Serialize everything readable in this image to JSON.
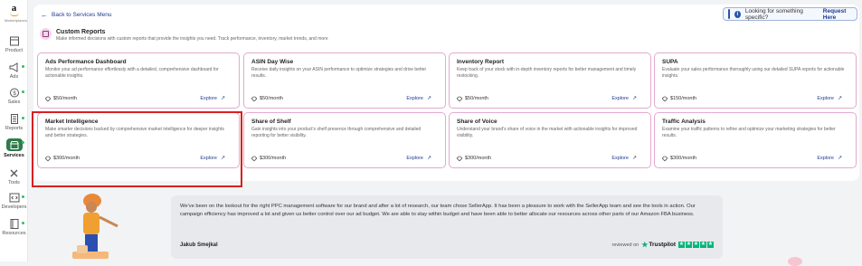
{
  "sidebar": {
    "logo_text": "a",
    "logo_sub": "Marketplaces",
    "items": [
      {
        "label": "Product",
        "icon": "box-icon",
        "active": false,
        "dot": false
      },
      {
        "label": "Ads",
        "icon": "megaphone-icon",
        "active": false,
        "dot": true
      },
      {
        "label": "Sales",
        "icon": "dollar-circle-icon",
        "active": false,
        "dot": true
      },
      {
        "label": "Reports",
        "icon": "document-icon",
        "active": false,
        "dot": true
      },
      {
        "label": "Services",
        "icon": "store-icon",
        "active": true,
        "dot": true
      },
      {
        "label": "Tools",
        "icon": "tools-icon",
        "active": false,
        "dot": false
      },
      {
        "label": "Developers",
        "icon": "code-icon",
        "active": false,
        "dot": true
      },
      {
        "label": "Resources",
        "icon": "book-icon",
        "active": false,
        "dot": true
      }
    ]
  },
  "header": {
    "back_label": "Back to Services Menu",
    "help_question": "Looking for something specific?",
    "help_link": "Request Here"
  },
  "section": {
    "title": "Custom Reports",
    "subtitle": "Make informed decisions with custom reports that provide the insights you need. Track performance, inventory, market trends, and more"
  },
  "cards": [
    {
      "title": "Ads Performance Dashboard",
      "desc": "Monitor your ad performance effortlessly with a detailed, comprehensive dashboard for actionable insights.",
      "price": "$50/month",
      "explore": "Explore"
    },
    {
      "title": "ASIN Day Wise",
      "desc": "Receive daily insights on your ASIN performance to optimize strategies and drive better results.",
      "price": "$50/month",
      "explore": "Explore"
    },
    {
      "title": "Inventory Report",
      "desc": "Keep track of your stock with in-depth inventory reports for better management and timely restocking.",
      "price": "$50/month",
      "explore": "Explore"
    },
    {
      "title": "SUPA",
      "desc": "Evaluate your sales performance thoroughly using our detailed SUPA reports for actionable insights.",
      "price": "$150/month",
      "explore": "Explore"
    },
    {
      "title": "Market Intelligence",
      "desc": "Make smarter decisions backed by comprehensive market intelligence for deeper insights and better strategies.",
      "price": "$300/month",
      "explore": "Explore"
    },
    {
      "title": "Share of Shelf",
      "desc": "Gain insights into your product's shelf presence through comprehensive and detailed reporting for better visibility.",
      "price": "$300/month",
      "explore": "Explore"
    },
    {
      "title": "Share of Voice",
      "desc": "Understand your brand's share of voice in the market with actionable insights for improved visibility.",
      "price": "$300/month",
      "explore": "Explore"
    },
    {
      "title": "Traffic Analysis",
      "desc": "Examine your traffic patterns to refine and optimize your marketing strategies for better results.",
      "price": "$300/month",
      "explore": "Explore"
    }
  ],
  "testimonial": {
    "text": "We've been on the lookout for the right PPC management software for our brand and after a lot of research, our team chose SellerApp. It has been a pleasure to work with the SellerApp team and see the tools in action. Our campaign efficiency has improved a lot and given us better control over our ad budget. We are able to stay within budget and have been able to better allocate our resources across other parts of our Amazon FBA business.",
    "author": "Jakub Smejkal",
    "reviewed_on": "reviewed on",
    "brand": "Trustpilot",
    "rating": 5
  },
  "colors": {
    "accent_green": "#2f7a4b",
    "card_border": "#e3a9cf",
    "link_blue": "#1f3a93",
    "highlight_red": "#d82020",
    "trustpilot_green": "#00b67a"
  }
}
